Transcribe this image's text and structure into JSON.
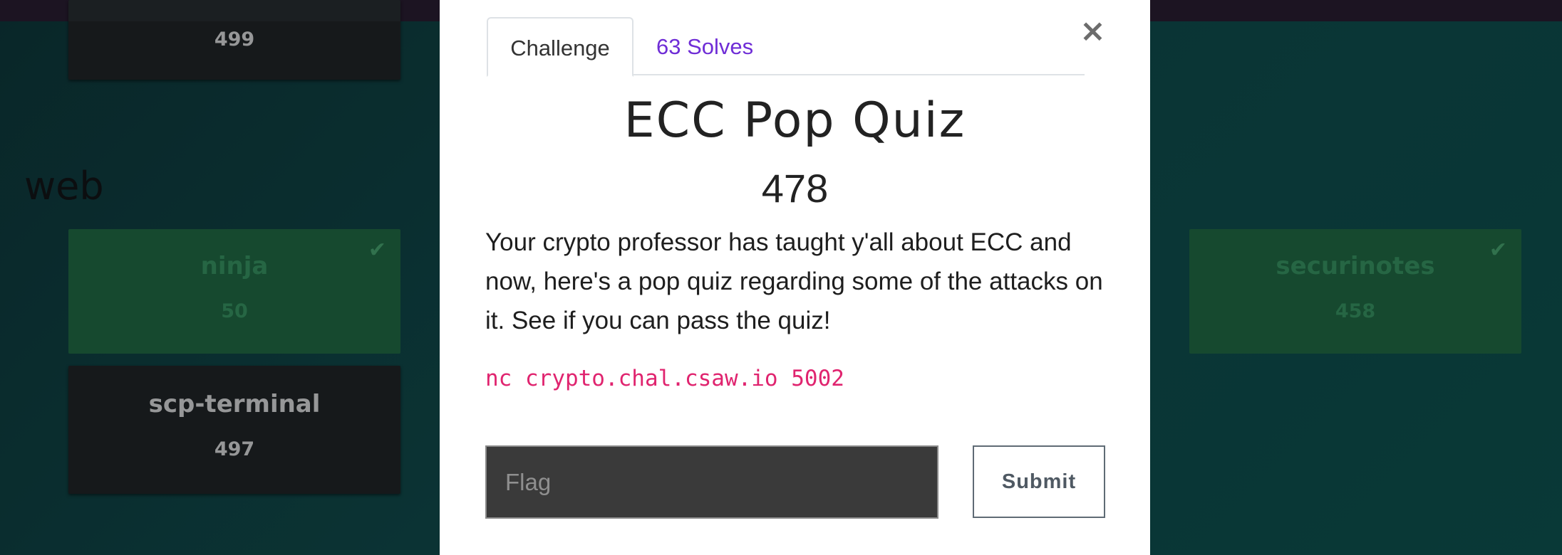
{
  "background": {
    "category": "web",
    "tiles": [
      {
        "name": "",
        "value": "499",
        "solved": false
      },
      {
        "name": "ninja",
        "value": "50",
        "solved": true
      },
      {
        "name": "scp-terminal",
        "value": "497",
        "solved": false
      },
      {
        "name": "securinotes",
        "value": "458",
        "solved": true
      }
    ]
  },
  "modal": {
    "tabs": {
      "challenge": "Challenge",
      "solves": "63 Solves"
    },
    "close_symbol": "×",
    "title": "ECC Pop Quiz",
    "points": "478",
    "description": "Your crypto professor has taught y'all about ECC and now, here's a pop quiz regarding some of the attacks on it. See if you can pass the quiz!",
    "connection": "nc crypto.chal.csaw.io 5002",
    "flag_placeholder": "Flag",
    "submit_label": "Submit"
  },
  "icons": {
    "solved": "check-icon",
    "close": "close-icon"
  },
  "colors": {
    "accent": "#6f2dd6",
    "code": "#e0246f",
    "solved_tile": "#1b5a3a",
    "topbar": "#1c1422"
  }
}
